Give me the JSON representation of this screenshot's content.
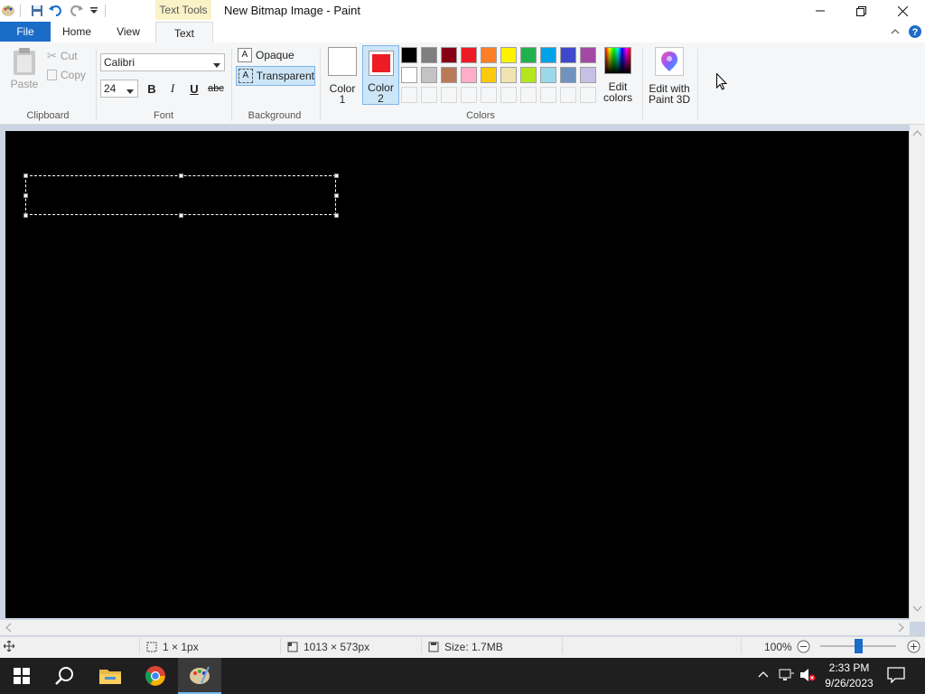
{
  "titlebar": {
    "context_tab": "Text Tools",
    "title": "New Bitmap Image - Paint"
  },
  "tabs": {
    "file": "File",
    "home": "Home",
    "view": "View",
    "text": "Text"
  },
  "clipboard": {
    "paste": "Paste",
    "cut": "Cut",
    "copy": "Copy",
    "group": "Clipboard"
  },
  "font": {
    "family": "Calibri",
    "size": "24",
    "bold": "B",
    "italic": "I",
    "underline": "U",
    "strike": "abc",
    "group": "Font"
  },
  "background": {
    "opaque": "Opaque",
    "transparent": "Transparent",
    "group": "Background"
  },
  "colors": {
    "color1_l1": "Color",
    "color1_l2": "1",
    "color2_l1": "Color",
    "color2_l2": "2",
    "color1_value": "#ffffff",
    "color2_value": "#ed1c24",
    "edit_l1": "Edit",
    "edit_l2": "colors",
    "paint3d_l1": "Edit with",
    "paint3d_l2": "Paint 3D",
    "group": "Colors",
    "palette_row1": [
      "#000000",
      "#7f7f7f",
      "#880015",
      "#ed1c24",
      "#ff7f27",
      "#fff200",
      "#22b14c",
      "#00a2e8",
      "#3f48cc",
      "#a349a4"
    ],
    "palette_row2": [
      "#ffffff",
      "#c3c3c3",
      "#b97a57",
      "#ffaec9",
      "#ffc90e",
      "#efe4b0",
      "#b5e61d",
      "#99d9ea",
      "#7092be",
      "#c8bfe7"
    ]
  },
  "status": {
    "selection": "1 × 1px",
    "canvas_size": "1013 × 573px",
    "file_size": "Size: 1.7MB",
    "zoom": "100%"
  },
  "taskbar": {
    "time": "2:33 PM",
    "date": "9/26/2023"
  }
}
